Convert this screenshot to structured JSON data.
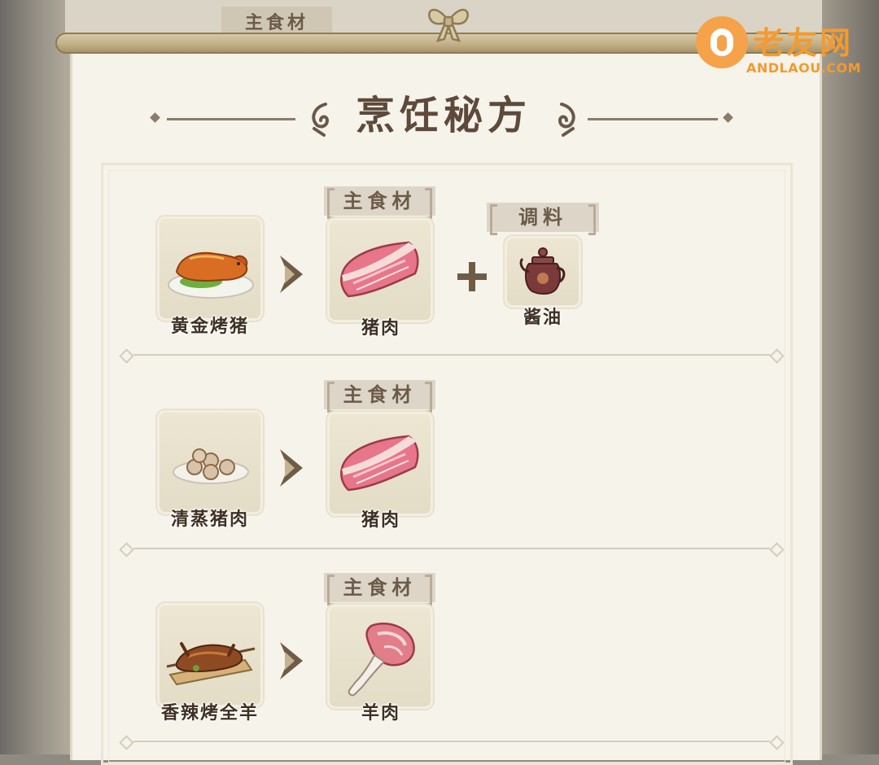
{
  "background": {
    "top_tab_label": "主食材"
  },
  "watermark": {
    "title": "老友网",
    "subtitle": "ANDLAOU.COM"
  },
  "panel": {
    "title": "烹饪秘方"
  },
  "recipes": [
    {
      "dish": "黄金烤猪",
      "dish_icon": "roast-pig-icon",
      "main_tag": "主食材",
      "main_ingredient": "猪肉",
      "main_icon": "pork-icon",
      "seasoning_tag": "调料",
      "seasoning": "酱油",
      "seasoning_icon": "soy-sauce-pot-icon"
    },
    {
      "dish": "清蒸猪肉",
      "dish_icon": "steamed-pork-icon",
      "main_tag": "主食材",
      "main_ingredient": "猪肉",
      "main_icon": "pork-icon"
    },
    {
      "dish": "香辣烤全羊",
      "dish_icon": "roast-lamb-icon",
      "main_tag": "主食材",
      "main_ingredient": "羊肉",
      "main_icon": "mutton-leg-icon"
    }
  ],
  "colors": {
    "paper": "#f6f3ea",
    "title": "#5d4a3a",
    "card": "#e3dcc6",
    "accent": "#8a7b6c"
  }
}
